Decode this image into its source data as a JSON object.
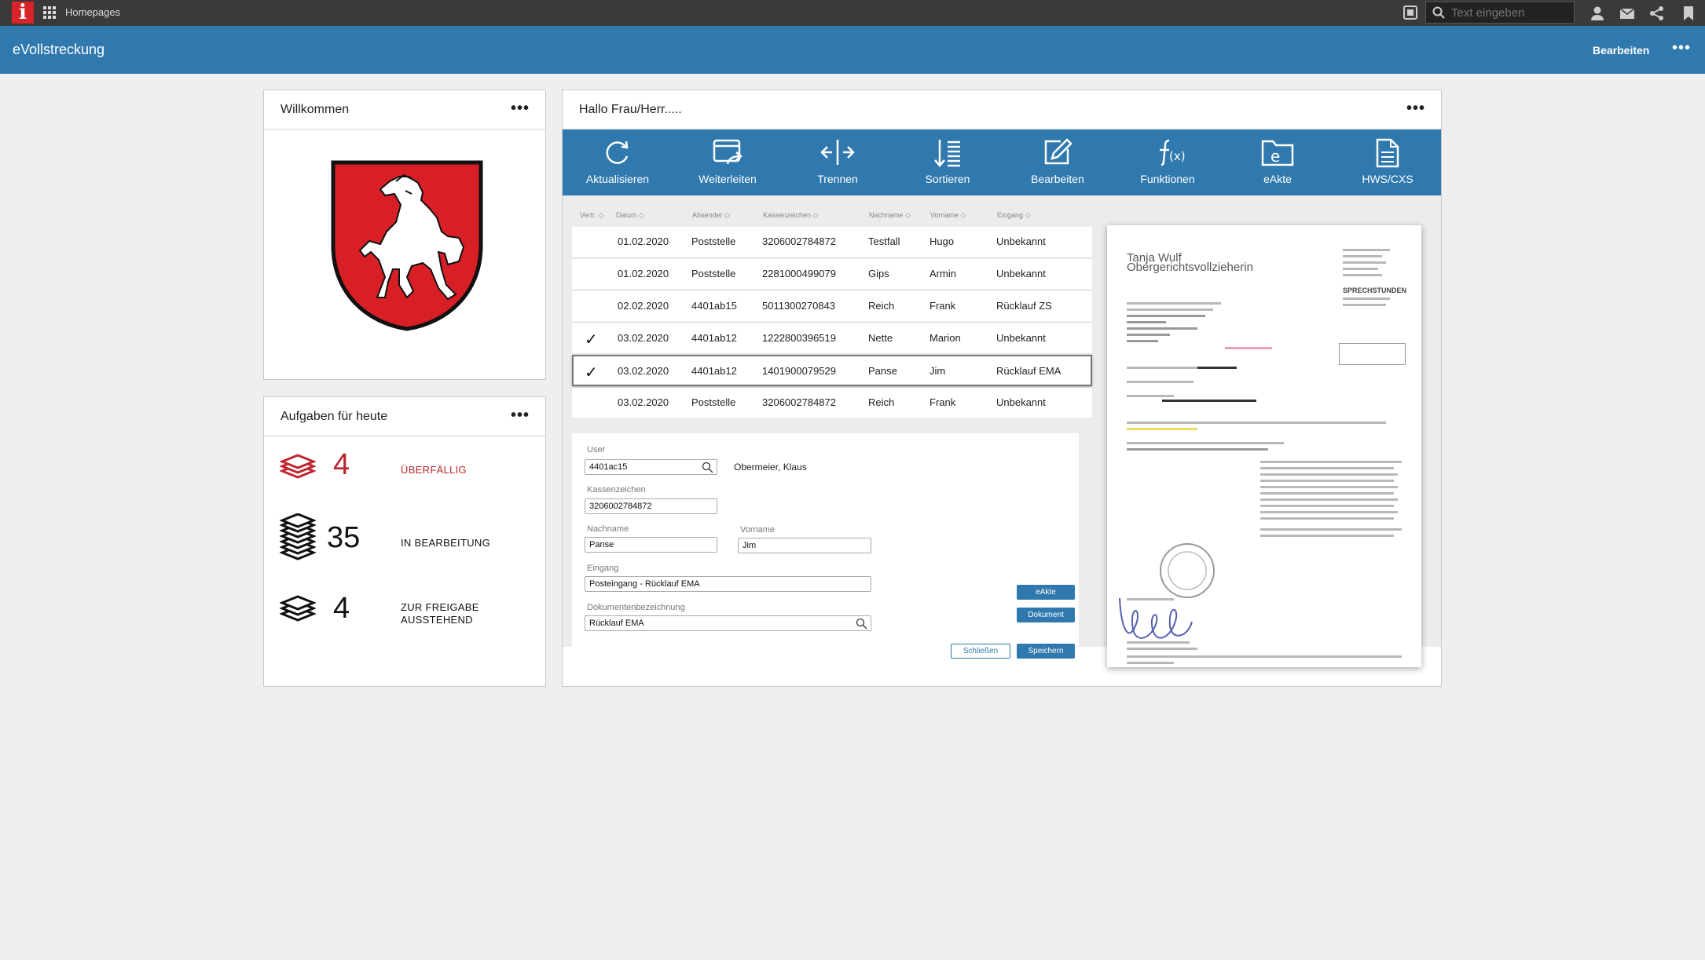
{
  "topbar": {
    "logo": "i",
    "homepages": "Homepages",
    "search_placeholder": "Text eingeben"
  },
  "appbar": {
    "title": "eVollstreckung",
    "edit_label": "Bearbeiten",
    "more": "•••"
  },
  "welcome": {
    "title": "Willkommen",
    "more": "•••"
  },
  "tasks": {
    "title": "Aufgaben für heute",
    "more": "•••",
    "items": [
      {
        "count": "4",
        "label": "ÜBERFÄLLIG",
        "color": "#b8262e"
      },
      {
        "count": "35",
        "label": "IN BEARBEITUNG",
        "color": "#222222"
      },
      {
        "count": "4",
        "label": "ZUR FREIGABE AUSSTEHEND",
        "color": "#222222"
      }
    ]
  },
  "main": {
    "title": "Hallo Frau/Herr.....",
    "more": "•••",
    "toolbar": [
      {
        "label": "Aktualisieren",
        "icon": "refresh-icon"
      },
      {
        "label": "Weiterleiten",
        "icon": "forward-icon"
      },
      {
        "label": "Trennen",
        "icon": "split-icon"
      },
      {
        "label": "Sortieren",
        "icon": "sort-icon"
      },
      {
        "label": "Bearbeiten",
        "icon": "edit-icon"
      },
      {
        "label": "Funktionen",
        "icon": "function-icon"
      },
      {
        "label": "eAkte",
        "icon": "eakte-folder-icon"
      },
      {
        "label": "HWS/CXS",
        "icon": "document-icon"
      }
    ],
    "table": {
      "headers": [
        "Vertr.",
        "Datum",
        "Absender",
        "Kassenzeichen",
        "Nachname",
        "Vorname",
        "Eingang"
      ],
      "rows": [
        {
          "checked": false,
          "datum": "01.02.2020",
          "absender": "Poststelle",
          "kassenzeichen": "3206002784872",
          "nachname": "Testfall",
          "vorname": "Hugo",
          "eingang": "Unbekannt"
        },
        {
          "checked": false,
          "datum": "01.02.2020",
          "absender": "Poststelle",
          "kassenzeichen": "2281000499079",
          "nachname": "Gips",
          "vorname": "Armin",
          "eingang": "Unbekannt"
        },
        {
          "checked": false,
          "datum": "02.02.2020",
          "absender": "4401ab15",
          "kassenzeichen": "5011300270843",
          "nachname": "Reich",
          "vorname": "Frank",
          "eingang": "Rücklauf ZS"
        },
        {
          "checked": true,
          "datum": "03.02.2020",
          "absender": "4401ab12",
          "kassenzeichen": "1222800396519",
          "nachname": "Nette",
          "vorname": "Marion",
          "eingang": "Unbekannt"
        },
        {
          "checked": true,
          "datum": "03.02.2020",
          "absender": "4401ab12",
          "kassenzeichen": "1401900079529",
          "nachname": "Panse",
          "vorname": "Jim",
          "eingang": "Rücklauf EMA"
        },
        {
          "checked": false,
          "datum": "03.02.2020",
          "absender": "Poststelle",
          "kassenzeichen": "3206002784872",
          "nachname": "Reich",
          "vorname": "Frank",
          "eingang": "Unbekannt"
        }
      ]
    },
    "form": {
      "user_label": "User",
      "user_value": "4401ac15",
      "user_name": "Obermeier, Klaus",
      "kassenzeichen_label": "Kassenzeichen",
      "kassenzeichen_value": "3206002784872",
      "nachname_label": "Nachname",
      "nachname_value": "Panse",
      "vorname_label": "Vorname",
      "vorname_value": "Jim",
      "eingang_label": "Eingang",
      "eingang_value": "Posteingang - Rücklauf EMA",
      "dokbez_label": "Dokumentenbezeichnung",
      "dokbez_value": "Rücklauf EMA",
      "btn_eakte": "eAkte",
      "btn_dokument": "Dokument",
      "btn_close": "Schließen",
      "btn_save": "Speichern"
    },
    "preview": {
      "name": "Tanja Wulf",
      "role": "Obergerichtsvollzieherin",
      "heading": "SPRECHSTUNDEN"
    }
  }
}
